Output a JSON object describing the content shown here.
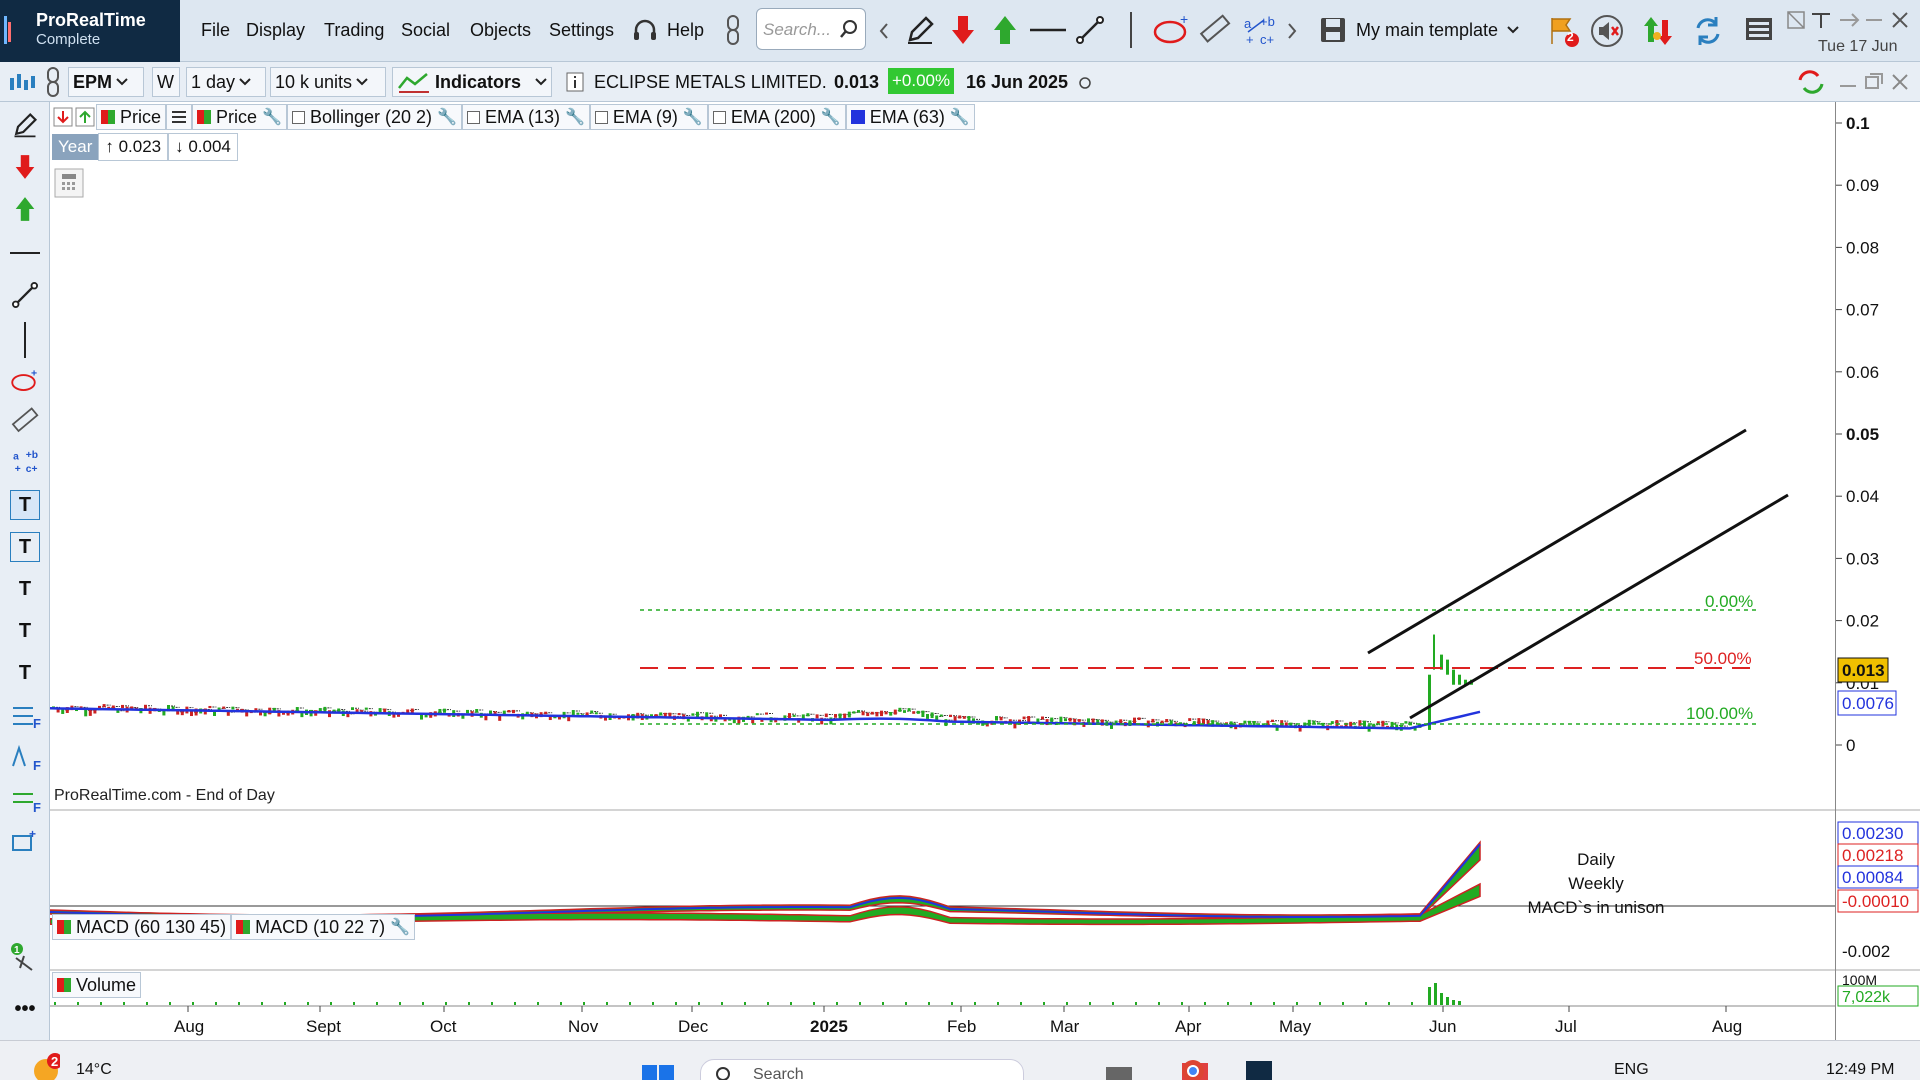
{
  "app": {
    "title": "ProRealTime",
    "subtitle": "Complete"
  },
  "menu": [
    "File",
    "Display",
    "Trading",
    "Social",
    "Objects",
    "Settings",
    "Help"
  ],
  "search": {
    "placeholder": "Search..."
  },
  "template": {
    "label": "My main template"
  },
  "badge_count": "2",
  "date_top": "Tue 17 Jun",
  "symbol_bar": {
    "ticker": "EPM",
    "w": "W",
    "timeframe": "1 day",
    "units": "10 k units",
    "indicators": "Indicators",
    "instrument": "ECLIPSE METALS LIMITED.",
    "price": "0.013",
    "change": "+0.00%",
    "date": "16 Jun 2025"
  },
  "legend": {
    "price1": "Price",
    "price2": "Price",
    "bollinger": "Bollinger (20 2)",
    "ema13": "EMA (13)",
    "ema9": "EMA (9)",
    "ema200": "EMA (200)",
    "ema63": "EMA (63)"
  },
  "year_tag": {
    "label": "Year",
    "up": "↑ 0.023",
    "down": "↓ 0.004"
  },
  "source": "ProRealTime.com - End of Day",
  "macd_legend": {
    "m1": "MACD (60 130 45)",
    "m2": "MACD (10 22 7)"
  },
  "volume_legend": "Volume",
  "annotation": [
    "Daily",
    "Weekly",
    "MACD`s in unison"
  ],
  "fib": {
    "l0": "0.00%",
    "l50": "50.00%",
    "l100": "100.00%"
  },
  "price_ticks": [
    "0.1",
    "0.09",
    "0.08",
    "0.07",
    "0.06",
    "0.05",
    "0.04",
    "0.03",
    "0.02",
    "0.01",
    "0"
  ],
  "price_tag": "0.013",
  "ema_tag": "0.0076",
  "macd_ticks": [
    "0.00230",
    "0.00218",
    "0.00084",
    "-0.00010",
    "-0.002"
  ],
  "volume_ticks": [
    "100M",
    "7,022k"
  ],
  "months": [
    "Aug",
    "Sept",
    "Oct",
    "Nov",
    "Dec",
    "2025",
    "Feb",
    "Mar",
    "Apr",
    "May",
    "Jun",
    "Jul",
    "Aug"
  ],
  "taskbar": {
    "temp": "14°C",
    "weather_badge": "2",
    "search": "Search",
    "lang": "ENG",
    "time": "12:49 PM"
  },
  "colors": {
    "accent": "#102a43",
    "ema63": "#2233dd",
    "fib_green": "#22aa22",
    "fib_red": "#dd2222",
    "up": "#22aa22",
    "down": "#cc2222"
  }
}
